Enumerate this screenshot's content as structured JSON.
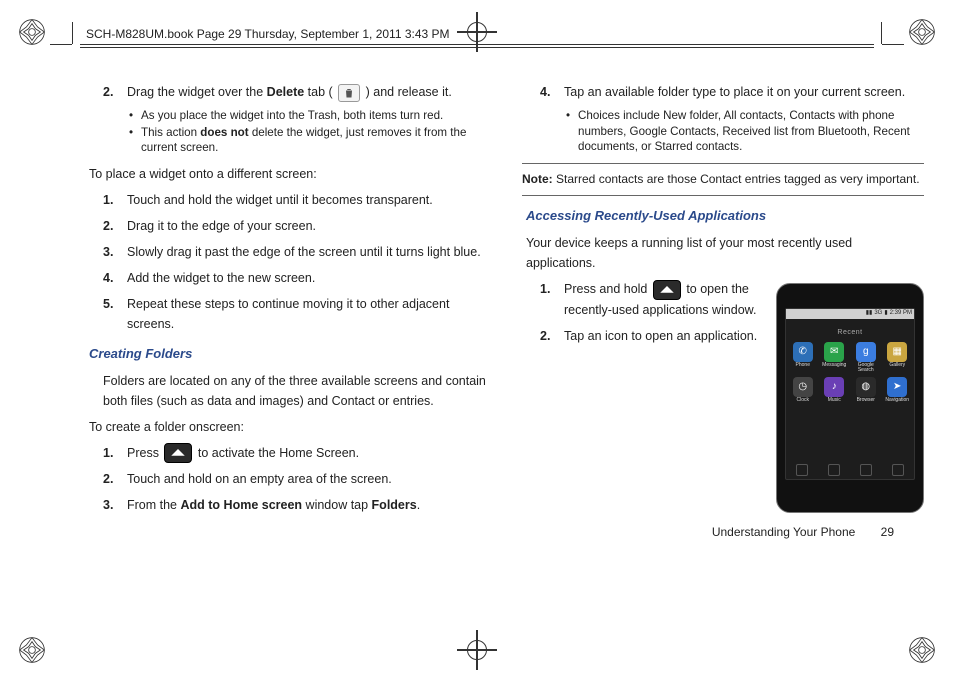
{
  "header": "SCH-M828UM.book  Page 29  Thursday, September 1, 2011  3:43 PM",
  "left": {
    "step2_a": "Drag the widget over the ",
    "step2_b": "Delete",
    "step2_c": " tab ( ",
    "step2_d": " ) and release it.",
    "b1": "As you place the widget into the Trash, both items turn red.",
    "b2a": "This action ",
    "b2b": "does not",
    "b2c": " delete the widget, just removes it from the current screen.",
    "intro2": "To place a widget onto a different screen:",
    "s1": "Touch and hold the widget until it becomes transparent.",
    "s2": "Drag it to the edge of your screen.",
    "s3": "Slowly drag it past the edge of the screen until it turns light blue.",
    "s4": "Add the widget to the new screen.",
    "s5": "Repeat these steps to continue moving it to other adjacent screens.",
    "h2": "Creating Folders",
    "p1": "Folders are located on any of the three available screens and contain both files (such as data and images) and Contact or entries.",
    "p2": "To create a folder onscreen:",
    "f1a": "Press  ",
    "f1b": "  to activate the Home Screen.",
    "f2": "Touch and hold on an empty area of the screen.",
    "f3a": "From the ",
    "f3b": "Add to Home screen",
    "f3c": " window tap ",
    "f3d": "Folders",
    "f3e": "."
  },
  "right": {
    "s4": "Tap an available folder type to place it on your current screen.",
    "b1": "Choices include New folder, All contacts, Contacts with phone numbers, Google Contacts, Received list from Bluetooth, Recent documents, or Starred contacts.",
    "noteLabel": "Note:",
    "noteText": " Starred contacts are those Contact entries tagged as very important.",
    "h2": "Accessing Recently-Used Applications",
    "p1": "Your device keeps a running list of your most recently used applications.",
    "r1a": "Press and hold  ",
    "r1b": " to open the recently-used applications window.",
    "r2": "Tap an icon to open an application."
  },
  "phone": {
    "time": "2:39 PM",
    "recent": "Recent",
    "apps": [
      {
        "name": "Phone",
        "color": "#2d6fb7",
        "glyph": "✆"
      },
      {
        "name": "Messaging",
        "color": "#2aa34a",
        "glyph": "✉"
      },
      {
        "name": "Google Search",
        "color": "#3b7de0",
        "glyph": "g"
      },
      {
        "name": "Gallery",
        "color": "#caa640",
        "glyph": "▦"
      },
      {
        "name": "Clock",
        "color": "#444",
        "glyph": "◷"
      },
      {
        "name": "Music",
        "color": "#6a3fb5",
        "glyph": "♪"
      },
      {
        "name": "Browser",
        "color": "#2a2a2a",
        "glyph": "◍"
      },
      {
        "name": "Navigation",
        "color": "#2f6fcf",
        "glyph": "➤"
      }
    ]
  },
  "footer": {
    "section": "Understanding Your Phone",
    "page": "29"
  }
}
